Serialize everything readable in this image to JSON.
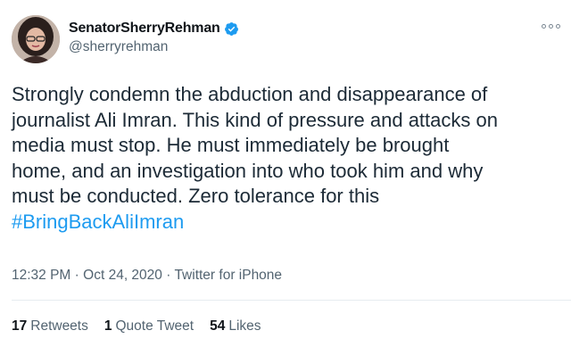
{
  "author": {
    "display_name": "SenatorSherryRehman",
    "handle": "@sherryrehman",
    "verified": true
  },
  "tweet": {
    "lines": [
      "Strongly condemn the abduction and disappearance of",
      "journalist Ali Imran. This kind of pressure and attacks on",
      "media must stop. He must immediately be brought",
      "home, and an investigation into who took him and why",
      "must be conducted. Zero tolerance for this"
    ],
    "hashtag": "#BringBackAliImran"
  },
  "meta": {
    "time": "12:32 PM",
    "separator": "·",
    "date": "Oct 24, 2020",
    "source": "Twitter for iPhone"
  },
  "stats": {
    "retweets": {
      "count": "17",
      "label": "Retweets"
    },
    "quotes": {
      "count": "1",
      "label": "Quote Tweet"
    },
    "likes": {
      "count": "54",
      "label": "Likes"
    }
  },
  "colors": {
    "link": "#1d9bf0",
    "verified": "#1d9bf0",
    "secondary_text": "#536471"
  },
  "icons": [
    "avatar",
    "verified-badge-icon",
    "more-options-icon"
  ]
}
